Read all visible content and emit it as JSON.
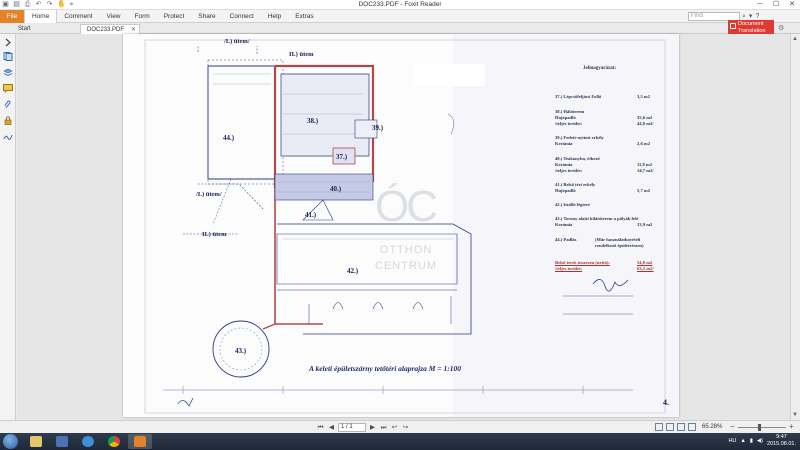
{
  "window": {
    "title": "DOC233.PDF - Foxit Reader",
    "controls": [
      "─",
      "☐",
      "✕"
    ]
  },
  "quick_access": [
    "open-icon",
    "save-icon",
    "print-icon",
    "undo-icon",
    "redo-icon",
    "hand-icon",
    "select-icon"
  ],
  "ribbon": {
    "file_label": "File",
    "tabs": [
      "Home",
      "Comment",
      "View",
      "Form",
      "Protect",
      "Share",
      "Connect",
      "Help",
      "Extras"
    ],
    "find_placeholder": "Find",
    "translation_label": "Document Translation"
  },
  "doc_tabs": {
    "start_label": "Start",
    "file_label": "DOC233.PDF",
    "close_glyph": "✕"
  },
  "document": {
    "header": "Jelmagyarázat:",
    "legend": [
      {
        "label": "37.) Lépcsőfeljáró  Folló",
        "value": "3,5 m2"
      },
      {
        "label": "38.) Hálóterem",
        "value": ""
      },
      {
        "label": "      Hajópadló",
        "value": "35,6 m2"
      },
      {
        "label": "      /teljes terület:",
        "value": "44,8 m2/"
      },
      {
        "label": "39.) Fedett-nyitott erkély",
        "value": ""
      },
      {
        "label": "      Kerámia",
        "value": "2,6 m2"
      },
      {
        "label": "40.) Teakonyha, étkező",
        "value": ""
      },
      {
        "label": "      Kerámia",
        "value": "11,8 m2"
      },
      {
        "label": "      /teljes terület:",
        "value": "14,7 m2/"
      },
      {
        "label": "41.) Belső téri erkély",
        "value": ""
      },
      {
        "label": "      Hajópadló",
        "value": "5,7 m2"
      },
      {
        "label": "42.) Istálló légtere",
        "value": ""
      },
      {
        "label": "43.) Torony alatti kilátóterem a pályák felé",
        "value": ""
      },
      {
        "label": "      Kerámia",
        "value": "13,9 m2"
      },
      {
        "label": "44.) Padlás",
        "value": "(Már használatbavételi"
      },
      {
        "label": "",
        "value": "rendelkező épületrészen)"
      },
      {
        "label": "Belső terek összesen (nettó):",
        "value": "54,0 m2"
      },
      {
        "label": "      /teljes terület:",
        "value": "63,2 m2/"
      }
    ],
    "caption": "A keleti épületszárny tetőtéri alaprajza     M = 1:100",
    "rooms": [
      "44.)",
      "38.)",
      "39.)",
      "37.)",
      "40.)",
      "41.)",
      "42.)",
      "43.)"
    ],
    "etap_labels": [
      "/I.) ütem/",
      "II.) ütem",
      "/I.) ütem/",
      "II.) ütem"
    ],
    "page_number": "4.",
    "watermark": {
      "logo": "ÓC",
      "line1": "OTTHON",
      "line2": "CENTRUM"
    }
  },
  "status": {
    "page_value": "1 / 1",
    "zoom": "65.28%"
  },
  "taskbar": {
    "lang": "HU",
    "time": "9:47",
    "date": "2015.08.01."
  },
  "colors": {
    "file_tab": "#e2822a",
    "translate": "#dd3a32",
    "plan_ink": "#2a3a86",
    "wall_red": "#b04a4a"
  }
}
